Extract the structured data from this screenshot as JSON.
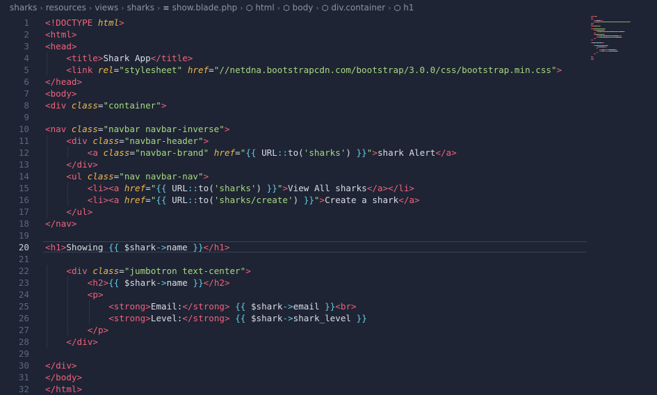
{
  "breadcrumb": [
    {
      "label": "sharks",
      "icon": ""
    },
    {
      "label": "resources",
      "icon": ""
    },
    {
      "label": "views",
      "icon": ""
    },
    {
      "label": "sharks",
      "icon": ""
    },
    {
      "label": "show.blade.php",
      "icon": "≡"
    },
    {
      "label": "html",
      "icon": "⬡"
    },
    {
      "label": "body",
      "icon": "⬡"
    },
    {
      "label": "div.container",
      "icon": "⬡"
    },
    {
      "label": "h1",
      "icon": "⬡"
    }
  ],
  "active_line": 20,
  "colors": {
    "tag": "#f2617e",
    "attr": "#f0b84e",
    "string": "#a7d883",
    "text": "#d8dde6",
    "brace": "#63c9e2",
    "background": "#1e2433"
  },
  "lines": [
    {
      "n": "1",
      "ind": 0,
      "tokens": [
        [
          "doc",
          "<!DOCTYPE "
        ],
        [
          "attr",
          "html"
        ],
        [
          "doc",
          ">"
        ]
      ]
    },
    {
      "n": "2",
      "ind": 0,
      "tokens": [
        [
          "tag",
          "<html>"
        ]
      ]
    },
    {
      "n": "3",
      "ind": 0,
      "tokens": [
        [
          "tag",
          "<head>"
        ]
      ]
    },
    {
      "n": "4",
      "ind": 1,
      "tokens": [
        [
          "tag",
          "<title>"
        ],
        [
          "txt",
          "Shark App"
        ],
        [
          "tag",
          "</title>"
        ]
      ]
    },
    {
      "n": "5",
      "ind": 1,
      "tokens": [
        [
          "tag",
          "<link "
        ],
        [
          "attr",
          "rel"
        ],
        [
          "punc",
          "="
        ],
        [
          "str",
          "\"stylesheet\" "
        ],
        [
          "attr",
          "href"
        ],
        [
          "punc",
          "="
        ],
        [
          "str",
          "\"//netdna.bootstrapcdn.com/bootstrap/3.0.0/css/bootstrap.min.css\""
        ],
        [
          "tag",
          ">"
        ]
      ]
    },
    {
      "n": "6",
      "ind": 0,
      "tokens": [
        [
          "tag",
          "</head>"
        ]
      ]
    },
    {
      "n": "7",
      "ind": 0,
      "tokens": [
        [
          "tag",
          "<body>"
        ]
      ]
    },
    {
      "n": "8",
      "ind": 0,
      "tokens": [
        [
          "tag",
          "<div "
        ],
        [
          "attr",
          "class"
        ],
        [
          "punc",
          "="
        ],
        [
          "str",
          "\"container\""
        ],
        [
          "tag",
          ">"
        ]
      ]
    },
    {
      "n": "9",
      "ind": 0,
      "tokens": []
    },
    {
      "n": "10",
      "ind": 0,
      "tokens": [
        [
          "tag",
          "<nav "
        ],
        [
          "attr",
          "class"
        ],
        [
          "punc",
          "="
        ],
        [
          "str",
          "\"navbar navbar-inverse\""
        ],
        [
          "tag",
          ">"
        ]
      ]
    },
    {
      "n": "11",
      "ind": 1,
      "tokens": [
        [
          "tag",
          "<div "
        ],
        [
          "attr",
          "class"
        ],
        [
          "punc",
          "="
        ],
        [
          "str",
          "\"navbar-header\""
        ],
        [
          "tag",
          ">"
        ]
      ]
    },
    {
      "n": "12",
      "ind": 2,
      "tokens": [
        [
          "tag",
          "<a "
        ],
        [
          "attr",
          "class"
        ],
        [
          "punc",
          "="
        ],
        [
          "str",
          "\"navbar-brand\" "
        ],
        [
          "attr",
          "href"
        ],
        [
          "punc",
          "="
        ],
        [
          "str",
          "\""
        ],
        [
          "brace",
          "{{ "
        ],
        [
          "fn",
          "URL"
        ],
        [
          "op",
          "::"
        ],
        [
          "fn",
          "to("
        ],
        [
          "str",
          "'sharks'"
        ],
        [
          "fn",
          ") "
        ],
        [
          "brace",
          "}}"
        ],
        [
          "str",
          "\""
        ],
        [
          "tag",
          ">"
        ],
        [
          "txt",
          "shark Alert"
        ],
        [
          "tag",
          "</a>"
        ]
      ]
    },
    {
      "n": "13",
      "ind": 1,
      "tokens": [
        [
          "tag",
          "</div>"
        ]
      ]
    },
    {
      "n": "14",
      "ind": 1,
      "tokens": [
        [
          "tag",
          "<ul "
        ],
        [
          "attr",
          "class"
        ],
        [
          "punc",
          "="
        ],
        [
          "str",
          "\"nav navbar-nav\""
        ],
        [
          "tag",
          ">"
        ]
      ]
    },
    {
      "n": "15",
      "ind": 2,
      "tokens": [
        [
          "tag",
          "<li><a "
        ],
        [
          "attr",
          "href"
        ],
        [
          "punc",
          "="
        ],
        [
          "str",
          "\""
        ],
        [
          "brace",
          "{{ "
        ],
        [
          "fn",
          "URL"
        ],
        [
          "op",
          "::"
        ],
        [
          "fn",
          "to("
        ],
        [
          "str",
          "'sharks'"
        ],
        [
          "fn",
          ") "
        ],
        [
          "brace",
          "}}"
        ],
        [
          "str",
          "\""
        ],
        [
          "tag",
          ">"
        ],
        [
          "txt",
          "View All sharks"
        ],
        [
          "tag",
          "</a></li>"
        ]
      ]
    },
    {
      "n": "16",
      "ind": 2,
      "tokens": [
        [
          "tag",
          "<li><a "
        ],
        [
          "attr",
          "href"
        ],
        [
          "punc",
          "="
        ],
        [
          "str",
          "\""
        ],
        [
          "brace",
          "{{ "
        ],
        [
          "fn",
          "URL"
        ],
        [
          "op",
          "::"
        ],
        [
          "fn",
          "to("
        ],
        [
          "str",
          "'sharks/create'"
        ],
        [
          "fn",
          ") "
        ],
        [
          "brace",
          "}}"
        ],
        [
          "str",
          "\""
        ],
        [
          "tag",
          ">"
        ],
        [
          "txt",
          "Create a shark"
        ],
        [
          "tag",
          "</a>"
        ]
      ]
    },
    {
      "n": "17",
      "ind": 1,
      "tokens": [
        [
          "tag",
          "</ul>"
        ]
      ]
    },
    {
      "n": "18",
      "ind": 0,
      "tokens": [
        [
          "tag",
          "</nav>"
        ]
      ]
    },
    {
      "n": "19",
      "ind": 0,
      "tokens": []
    },
    {
      "n": "20",
      "ind": 0,
      "tokens": [
        [
          "tag",
          "<h1>"
        ],
        [
          "txt",
          "Showing "
        ],
        [
          "brace",
          "{{ "
        ],
        [
          "var",
          "$shark"
        ],
        [
          "op",
          "->"
        ],
        [
          "var",
          "name "
        ],
        [
          "brace",
          "}}"
        ],
        [
          "tag",
          "</h1>"
        ]
      ]
    },
    {
      "n": "21",
      "ind": 0,
      "tokens": []
    },
    {
      "n": "22",
      "ind": 1,
      "tokens": [
        [
          "tag",
          "<div "
        ],
        [
          "attr",
          "class"
        ],
        [
          "punc",
          "="
        ],
        [
          "str",
          "\"jumbotron text-center\""
        ],
        [
          "tag",
          ">"
        ]
      ]
    },
    {
      "n": "23",
      "ind": 2,
      "tokens": [
        [
          "tag",
          "<h2>"
        ],
        [
          "brace",
          "{{ "
        ],
        [
          "var",
          "$shark"
        ],
        [
          "op",
          "->"
        ],
        [
          "var",
          "name "
        ],
        [
          "brace",
          "}}"
        ],
        [
          "tag",
          "</h2>"
        ]
      ]
    },
    {
      "n": "24",
      "ind": 2,
      "tokens": [
        [
          "tag",
          "<p>"
        ]
      ]
    },
    {
      "n": "25",
      "ind": 3,
      "tokens": [
        [
          "tag",
          "<strong>"
        ],
        [
          "txt",
          "Email:"
        ],
        [
          "tag",
          "</strong> "
        ],
        [
          "brace",
          "{{ "
        ],
        [
          "var",
          "$shark"
        ],
        [
          "op",
          "->"
        ],
        [
          "var",
          "email "
        ],
        [
          "brace",
          "}}"
        ],
        [
          "tag",
          "<br>"
        ]
      ]
    },
    {
      "n": "26",
      "ind": 3,
      "tokens": [
        [
          "tag",
          "<strong>"
        ],
        [
          "txt",
          "Level:"
        ],
        [
          "tag",
          "</strong> "
        ],
        [
          "brace",
          "{{ "
        ],
        [
          "var",
          "$shark"
        ],
        [
          "op",
          "->"
        ],
        [
          "var",
          "shark_level "
        ],
        [
          "brace",
          "}}"
        ]
      ]
    },
    {
      "n": "27",
      "ind": 2,
      "tokens": [
        [
          "tag",
          "</p>"
        ]
      ]
    },
    {
      "n": "28",
      "ind": 1,
      "tokens": [
        [
          "tag",
          "</div>"
        ]
      ]
    },
    {
      "n": "29",
      "ind": 0,
      "tokens": []
    },
    {
      "n": "30",
      "ind": 0,
      "tokens": [
        [
          "tag",
          "</div>"
        ]
      ]
    },
    {
      "n": "31",
      "ind": 0,
      "tokens": [
        [
          "tag",
          "</body>"
        ]
      ]
    },
    {
      "n": "32",
      "ind": 0,
      "tokens": [
        [
          "tag",
          "</html>"
        ]
      ]
    }
  ]
}
